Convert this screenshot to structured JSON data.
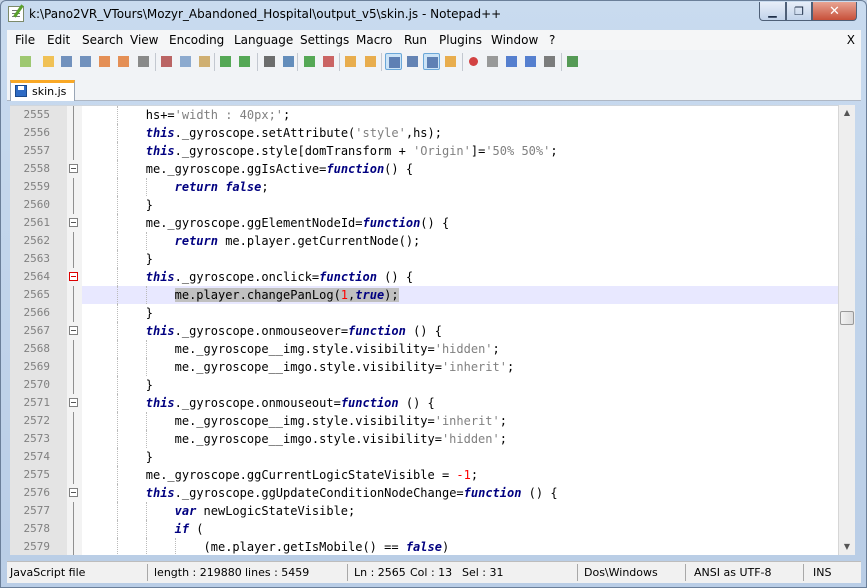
{
  "window": {
    "title": "k:\\Pano2VR_VTours\\Mozyr_Abandoned_Hospital\\output_v5\\skin.js - Notepad++",
    "minimize": "▁",
    "maximize": "❐",
    "close": "✕"
  },
  "menu": {
    "items": [
      "File",
      "Edit",
      "Search",
      "View",
      "Encoding",
      "Language",
      "Settings",
      "Macro",
      "Run",
      "Plugins",
      "Window",
      "?"
    ],
    "close_label": "X"
  },
  "tabs": [
    {
      "label": "skin.js"
    }
  ],
  "colors": {
    "keyword": "#000080",
    "string": "#808080",
    "number": "#ff0000",
    "current_line": "#e8e8ff"
  },
  "editor": {
    "lines": [
      {
        "n": "2555",
        "indent": 2,
        "fold": "line",
        "tokens": [
          [
            "t",
            "hs+="
          ],
          [
            "s",
            "'width : 40px;'"
          ],
          [
            "t",
            ";"
          ]
        ]
      },
      {
        "n": "2556",
        "indent": 2,
        "fold": "line",
        "tokens": [
          [
            "k",
            "this"
          ],
          [
            "t",
            "._gyroscope.setAttribute("
          ],
          [
            "s",
            "'style'"
          ],
          [
            "t",
            ",hs);"
          ]
        ]
      },
      {
        "n": "2557",
        "indent": 2,
        "fold": "line",
        "tokens": [
          [
            "k",
            "this"
          ],
          [
            "t",
            "._gyroscope.style[domTransform + "
          ],
          [
            "s",
            "'Origin'"
          ],
          [
            "t",
            "]="
          ],
          [
            "s",
            "'50% 50%'"
          ],
          [
            "t",
            ";"
          ]
        ]
      },
      {
        "n": "2558",
        "indent": 2,
        "fold": "box",
        "tokens": [
          [
            "t",
            "me._gyroscope.ggIsActive="
          ],
          [
            "k",
            "function"
          ],
          [
            "t",
            "() {"
          ]
        ]
      },
      {
        "n": "2559",
        "indent": 3,
        "fold": "line",
        "tokens": [
          [
            "k",
            "return false"
          ],
          [
            "t",
            ";"
          ]
        ]
      },
      {
        "n": "2560",
        "indent": 2,
        "fold": "line",
        "tokens": [
          [
            "t",
            "}"
          ]
        ]
      },
      {
        "n": "2561",
        "indent": 2,
        "fold": "box",
        "tokens": [
          [
            "t",
            "me._gyroscope.ggElementNodeId="
          ],
          [
            "k",
            "function"
          ],
          [
            "t",
            "() {"
          ]
        ]
      },
      {
        "n": "2562",
        "indent": 3,
        "fold": "line",
        "tokens": [
          [
            "k",
            "return"
          ],
          [
            "t",
            " me.player.getCurrentNode();"
          ]
        ]
      },
      {
        "n": "2563",
        "indent": 2,
        "fold": "line",
        "tokens": [
          [
            "t",
            "}"
          ]
        ]
      },
      {
        "n": "2564",
        "indent": 2,
        "fold": "red",
        "tokens": [
          [
            "k",
            "this"
          ],
          [
            "t",
            "._gyroscope.onclick="
          ],
          [
            "k",
            "function"
          ],
          [
            "t",
            " () {"
          ]
        ]
      },
      {
        "n": "2565",
        "indent": 3,
        "fold": "line",
        "current": true,
        "tokens": [
          [
            "h",
            "me.player.changePanLog("
          ],
          [
            "hn",
            "1"
          ],
          [
            "h",
            ","
          ],
          [
            "hk",
            "true"
          ],
          [
            "h",
            ");"
          ]
        ]
      },
      {
        "n": "2566",
        "indent": 2,
        "fold": "line",
        "tokens": [
          [
            "t",
            "}"
          ]
        ]
      },
      {
        "n": "2567",
        "indent": 2,
        "fold": "box",
        "tokens": [
          [
            "k",
            "this"
          ],
          [
            "t",
            "._gyroscope.onmouseover="
          ],
          [
            "k",
            "function"
          ],
          [
            "t",
            " () {"
          ]
        ]
      },
      {
        "n": "2568",
        "indent": 3,
        "fold": "line",
        "tokens": [
          [
            "t",
            "me._gyroscope__img.style.visibility="
          ],
          [
            "s",
            "'hidden'"
          ],
          [
            "t",
            ";"
          ]
        ]
      },
      {
        "n": "2569",
        "indent": 3,
        "fold": "line",
        "tokens": [
          [
            "t",
            "me._gyroscope__imgo.style.visibility="
          ],
          [
            "s",
            "'inherit'"
          ],
          [
            "t",
            ";"
          ]
        ]
      },
      {
        "n": "2570",
        "indent": 2,
        "fold": "line",
        "tokens": [
          [
            "t",
            "}"
          ]
        ]
      },
      {
        "n": "2571",
        "indent": 2,
        "fold": "box",
        "tokens": [
          [
            "k",
            "this"
          ],
          [
            "t",
            "._gyroscope.onmouseout="
          ],
          [
            "k",
            "function"
          ],
          [
            "t",
            " () {"
          ]
        ]
      },
      {
        "n": "2572",
        "indent": 3,
        "fold": "line",
        "tokens": [
          [
            "t",
            "me._gyroscope__img.style.visibility="
          ],
          [
            "s",
            "'inherit'"
          ],
          [
            "t",
            ";"
          ]
        ]
      },
      {
        "n": "2573",
        "indent": 3,
        "fold": "line",
        "tokens": [
          [
            "t",
            "me._gyroscope__imgo.style.visibility="
          ],
          [
            "s",
            "'hidden'"
          ],
          [
            "t",
            ";"
          ]
        ]
      },
      {
        "n": "2574",
        "indent": 2,
        "fold": "line",
        "tokens": [
          [
            "t",
            "}"
          ]
        ]
      },
      {
        "n": "2575",
        "indent": 2,
        "fold": "line",
        "tokens": [
          [
            "t",
            "me._gyroscope.ggCurrentLogicStateVisible = "
          ],
          [
            "n",
            "-1"
          ],
          [
            "t",
            ";"
          ]
        ]
      },
      {
        "n": "2576",
        "indent": 2,
        "fold": "box",
        "tokens": [
          [
            "k",
            "this"
          ],
          [
            "t",
            "._gyroscope.ggUpdateConditionNodeChange="
          ],
          [
            "k",
            "function"
          ],
          [
            "t",
            " () {"
          ]
        ]
      },
      {
        "n": "2577",
        "indent": 3,
        "fold": "line",
        "tokens": [
          [
            "k",
            "var"
          ],
          [
            "t",
            " newLogicStateVisible;"
          ]
        ]
      },
      {
        "n": "2578",
        "indent": 3,
        "fold": "line",
        "tokens": [
          [
            "k",
            "if"
          ],
          [
            "t",
            " ("
          ]
        ]
      },
      {
        "n": "2579",
        "indent": 4,
        "fold": "line",
        "tokens": [
          [
            "t",
            "(me.player.getIsMobile() == "
          ],
          [
            "k",
            "false"
          ],
          [
            "t",
            ")"
          ]
        ]
      }
    ]
  },
  "status": {
    "language": "JavaScript file",
    "length": "length : 219880",
    "lines": "lines : 5459",
    "ln": "Ln : 2565",
    "col": "Col : 13",
    "sel": "Sel : 31",
    "eol": "Dos\\Windows",
    "encoding": "ANSI as UTF-8",
    "mode": "INS"
  },
  "toolbar": {
    "icons": [
      "new-file-icon",
      "open-file-icon",
      "save-icon",
      "save-all-icon",
      "close-icon",
      "close-all-icon",
      "print-icon",
      "cut-icon",
      "copy-icon",
      "paste-icon",
      "undo-icon",
      "redo-icon",
      "find-icon",
      "replace-icon",
      "zoom-in-icon",
      "zoom-out-icon",
      "sync-vertical-icon",
      "sync-horizontal-icon",
      "word-wrap-icon",
      "show-all-chars-icon",
      "indent-guide-icon",
      "user-lang-icon",
      "record-macro-icon",
      "stop-macro-icon",
      "play-macro-icon",
      "run-macro-multiple-icon",
      "save-macro-icon",
      "spellcheck-icon"
    ]
  }
}
